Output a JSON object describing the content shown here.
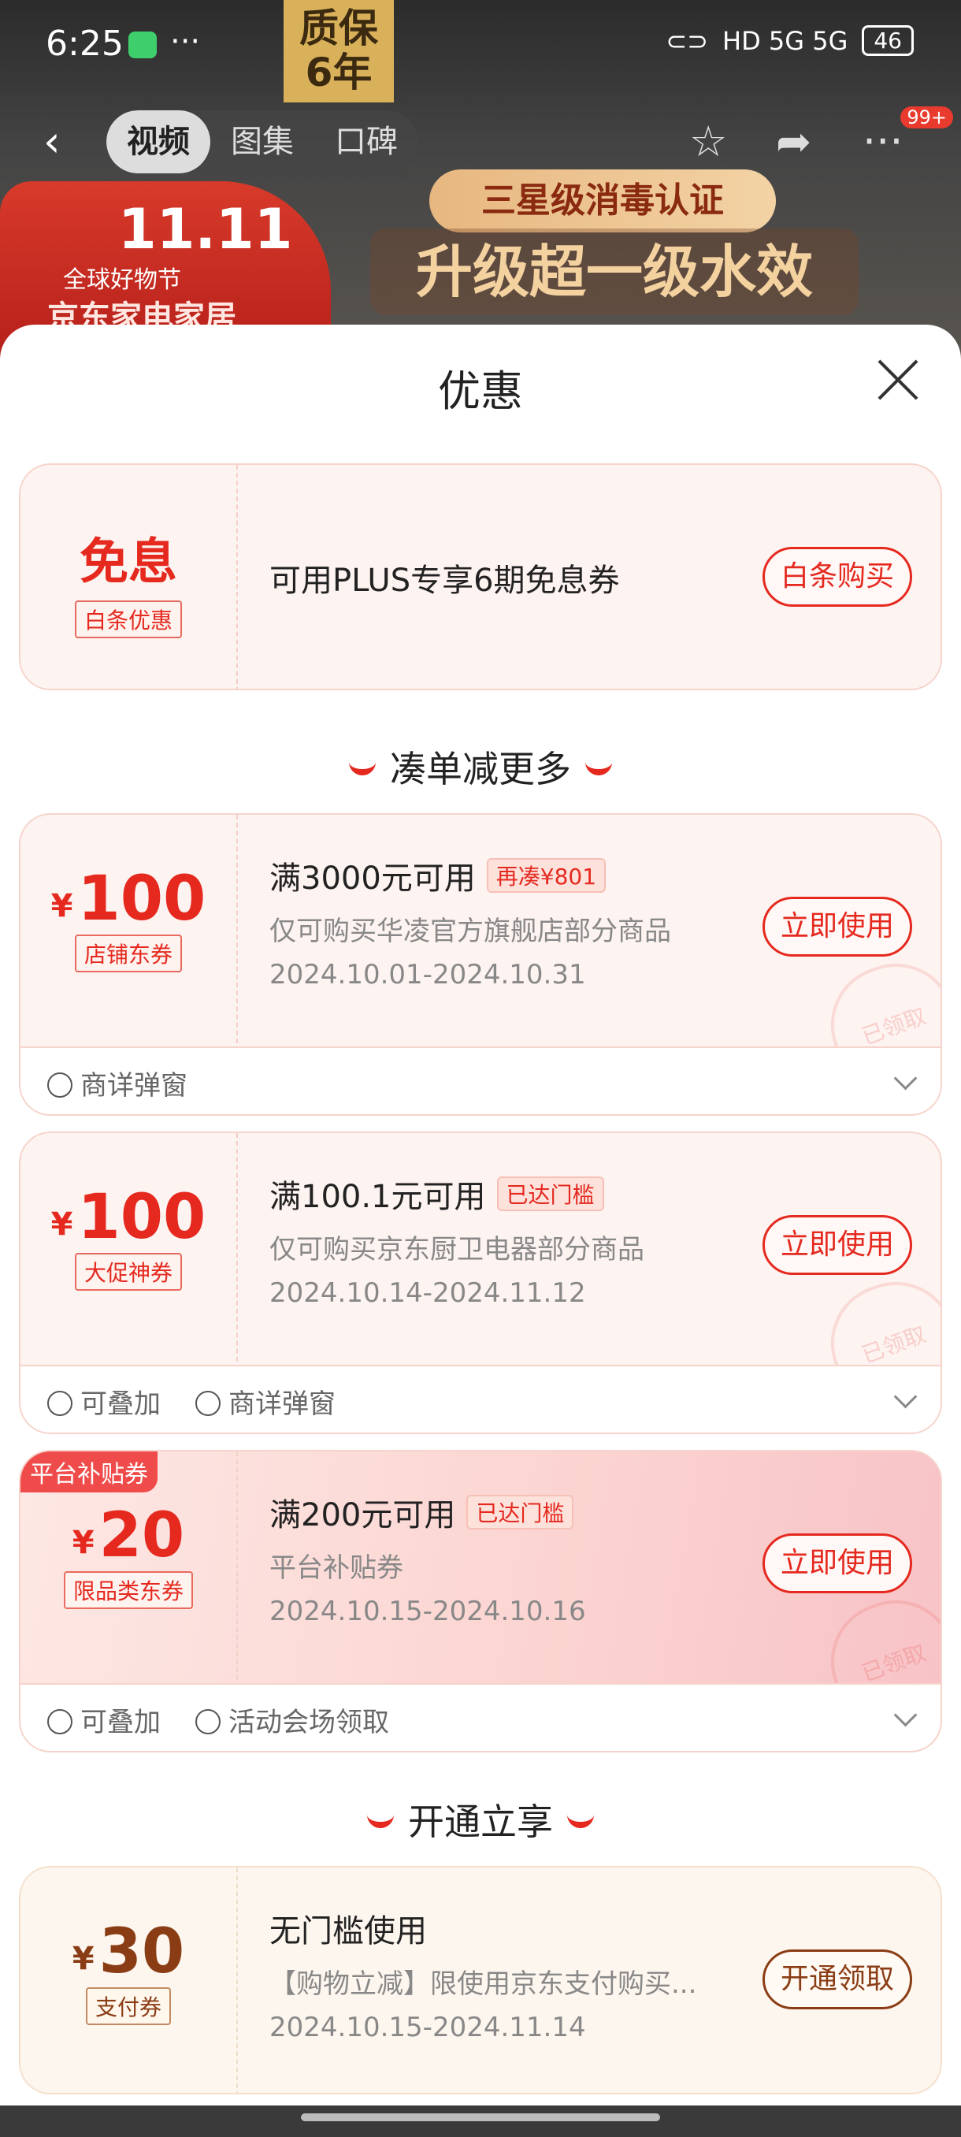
{
  "status_bar": {
    "time": "6:25",
    "network": "HD 5G 5G",
    "battery": "46"
  },
  "hero": {
    "warranty": [
      "质保",
      "6年"
    ],
    "festival_big": "11.11",
    "festival_line1": "全球好物节",
    "festival_line2": "京东家电家居",
    "badge_top": "三星级消毒认证",
    "badge_main": "升级超一级水效"
  },
  "nav": {
    "tabs": [
      "视频",
      "图集",
      "口碑"
    ],
    "message_count": "99+"
  },
  "sheet": {
    "title": "优惠",
    "plus_card": {
      "big": "免息",
      "tag": "白条优惠",
      "text": "可用PLUS专享6期免息券",
      "action": "白条购买"
    },
    "section1": "凑单减更多",
    "coupons": [
      {
        "yen": "¥",
        "amount": "100",
        "tag": "店铺东券",
        "line1": "满3000元可用",
        "chip": "再凑¥801",
        "line2": "仅可购买华凌官方旗舰店部分商品",
        "line3": "2024.10.01-2024.10.31",
        "action": "立即使用",
        "stamp": "已领取",
        "footer": [
          "商详弹窗"
        ]
      },
      {
        "yen": "¥",
        "amount": "100",
        "tag": "大促神券",
        "line1": "满100.1元可用",
        "chip": "已达门槛",
        "line2": "仅可购买京东厨卫电器部分商品",
        "line3": "2024.10.14-2024.11.12",
        "action": "立即使用",
        "stamp": "已领取",
        "footer": [
          "可叠加",
          "商详弹窗"
        ]
      },
      {
        "corner": "平台补贴券",
        "yen": "¥",
        "amount": "20",
        "tag": "限品类东券",
        "line1": "满200元可用",
        "chip": "已达门槛",
        "line2": "平台补贴券",
        "line3": "2024.10.15-2024.10.16",
        "action": "立即使用",
        "stamp": "已领取",
        "footer": [
          "可叠加",
          "活动会场领取"
        ]
      }
    ],
    "section2": "开通立享",
    "pay_card": {
      "yen": "¥",
      "amount": "30",
      "tag": "支付券",
      "line1": "无门槛使用",
      "line2": "【购物立减】限使用京东支付购买...",
      "line3": "2024.10.15-2024.11.14",
      "action": "开通领取"
    }
  }
}
